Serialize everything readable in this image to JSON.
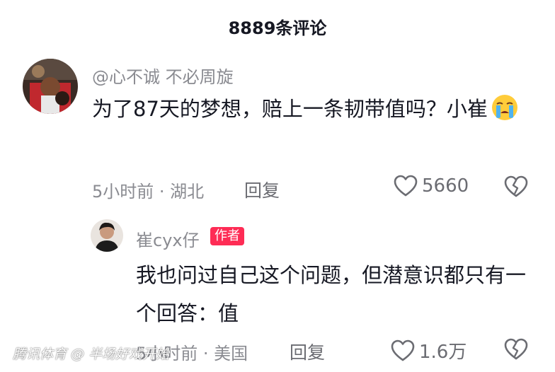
{
  "header": {
    "title": "8889条评论"
  },
  "comments": [
    {
      "username": "@心不诚 不必周旋",
      "text": "为了87天的梦想，赔上一条韧带值吗？小崔",
      "emoji": "crying-face",
      "meta": "5小时前 · 湖北",
      "reply_label": "回复",
      "likes": "5660"
    }
  ],
  "reply": {
    "username": "崔cyx仔",
    "badge": "作者",
    "text": "我也问过自己这个问题，但潜意识都只有一个回答：值",
    "meta": "5小时前 · 美国",
    "reply_label": "回复",
    "likes": "1.6万"
  },
  "watermark": "腾讯体育 @ 半场好戏开始",
  "colors": {
    "accent": "#fe2c55",
    "text_primary": "#161823",
    "text_secondary": "#8a8b91"
  }
}
